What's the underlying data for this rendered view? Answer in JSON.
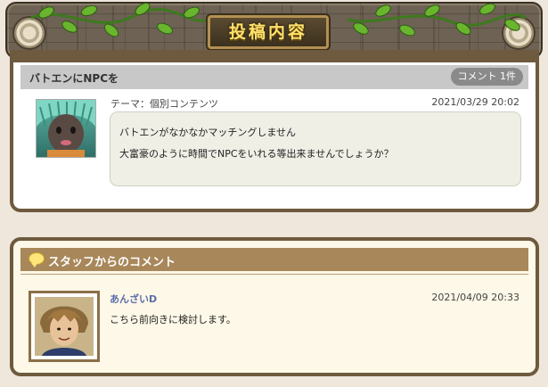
{
  "banner": {
    "title": "投稿内容"
  },
  "post": {
    "title": "バトエンにNPCを",
    "comment_count": "コメント 1件",
    "theme": "テーマ：個別コンテンツ",
    "date": "2021/03/29 20:02",
    "lines": [
      "バトエンがなかなかマッチングしません",
      "大富豪のように時間でNPCをいれる等出来ませんでしょうか？"
    ]
  },
  "staff": {
    "header": "スタッフからのコメント",
    "name": "あんざいD",
    "date": "2021/04/09 20:33",
    "comment": "こちら前向きに検討します。"
  },
  "colors": {
    "page_bg": "#efe7dc",
    "frame": "#6e5a3e",
    "header_gray": "#c8c8c8",
    "staff_header": "#a8875a",
    "title_gold": "#ffe36a",
    "staff_name": "#5b6da8"
  },
  "icons": [
    "vine-decoration-icon",
    "swirl-ornament-icon",
    "speech-bubble-icon"
  ]
}
